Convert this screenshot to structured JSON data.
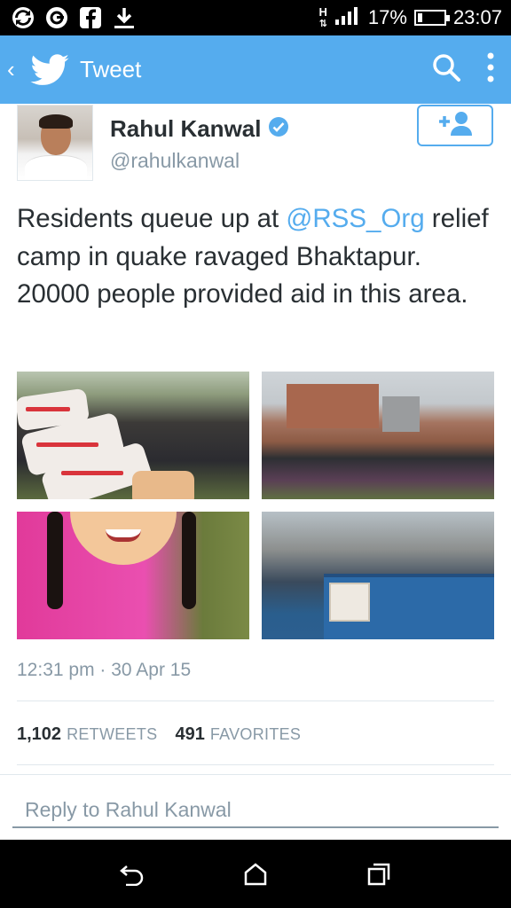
{
  "status_bar": {
    "left_icons": [
      "sync-icon",
      "browser-icon",
      "facebook-icon",
      "download-icon"
    ],
    "network_type": "H",
    "battery_percent": "17%",
    "battery_level": 0.17,
    "time": "23:07"
  },
  "action_bar": {
    "back_icon": "chevron-left-icon",
    "logo_icon": "twitter-bird-icon",
    "title": "Tweet",
    "search_icon": "search-icon",
    "overflow_icon": "more-vertical-icon",
    "color": "#55acee"
  },
  "tweet": {
    "author_name": "Rahul Kanwal",
    "verified_icon": "verified-badge-icon",
    "handle": "@rahulkanwal",
    "follow_icon": "add-user-icon",
    "text_before_mention": "Residents queue up at ",
    "mention": "@RSS_Org",
    "text_after_mention": " relief camp in quake ravaged Bhaktapur. 20000 people provided aid in this area.",
    "timestamp": "12:31 pm · 30 Apr 15",
    "retweets_count": "1,102",
    "retweets_label": "RETWEETS",
    "favorites_count": "491",
    "favorites_label": "FAVORITES"
  },
  "reply": {
    "placeholder": "Reply to Rahul Kanwal"
  },
  "nav_bar": {
    "back_icon": "back-arrow-icon",
    "home_icon": "home-icon",
    "recents_icon": "recent-apps-icon"
  },
  "colors": {
    "accent": "#55acee",
    "text": "#292f33",
    "muted": "#8899a6"
  }
}
